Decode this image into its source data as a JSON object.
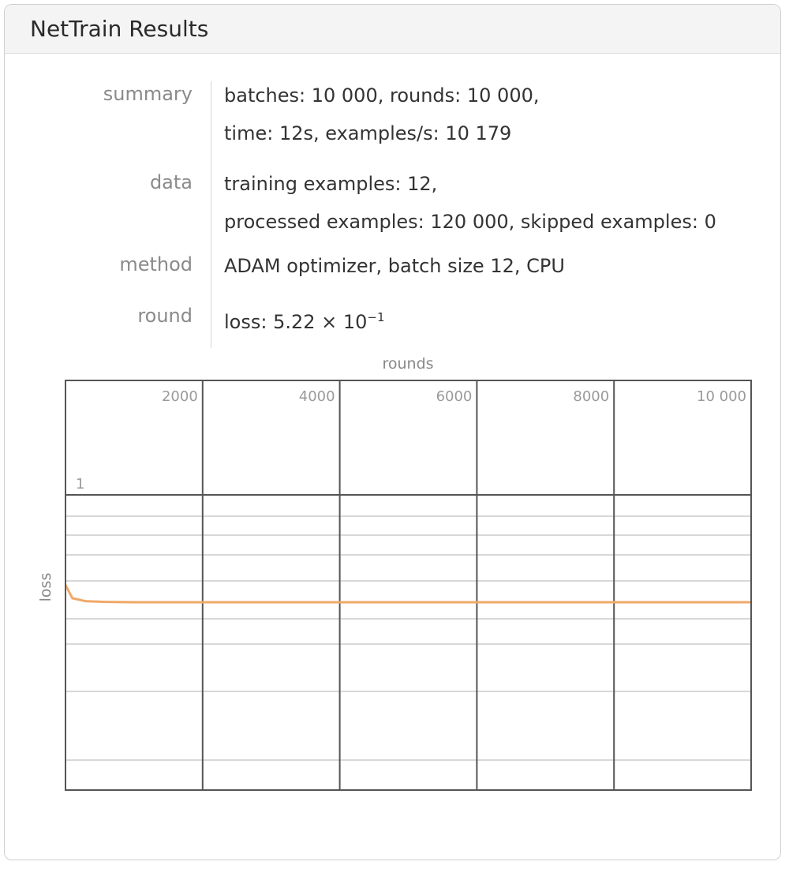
{
  "window": {
    "title": "NetTrain Results"
  },
  "info": {
    "summary": {
      "label": "summary",
      "lines": [
        "batches: 10 000, rounds: 10 000,",
        "time: 12s, examples/s: 10 179"
      ]
    },
    "data": {
      "label": "data",
      "lines": [
        "training examples: 12,",
        "processed examples: 120 000, skipped examples: 0"
      ]
    },
    "method": {
      "label": "method",
      "lines": [
        "ADAM optimizer, batch size 12, CPU"
      ]
    },
    "round": {
      "label": "round",
      "loss_prefix": "loss: 5.22 × 10",
      "loss_exponent": "−1"
    }
  },
  "chart_data": {
    "type": "line",
    "title": "",
    "xlabel": "rounds",
    "ylabel": "loss",
    "xlim": [
      0,
      10000
    ],
    "x_ticks": [
      "2000",
      "4000",
      "6000",
      "8000",
      "10 000"
    ],
    "y_tick_label": "1",
    "scale": "log",
    "grid": true,
    "series": [
      {
        "x": [
          0,
          100,
          300,
          600,
          1000,
          2000,
          4000,
          6000,
          8000,
          10000
        ],
        "y": [
          0.58,
          0.535,
          0.525,
          0.523,
          0.522,
          0.522,
          0.522,
          0.522,
          0.522,
          0.522
        ],
        "color": "#f0a868"
      }
    ]
  }
}
